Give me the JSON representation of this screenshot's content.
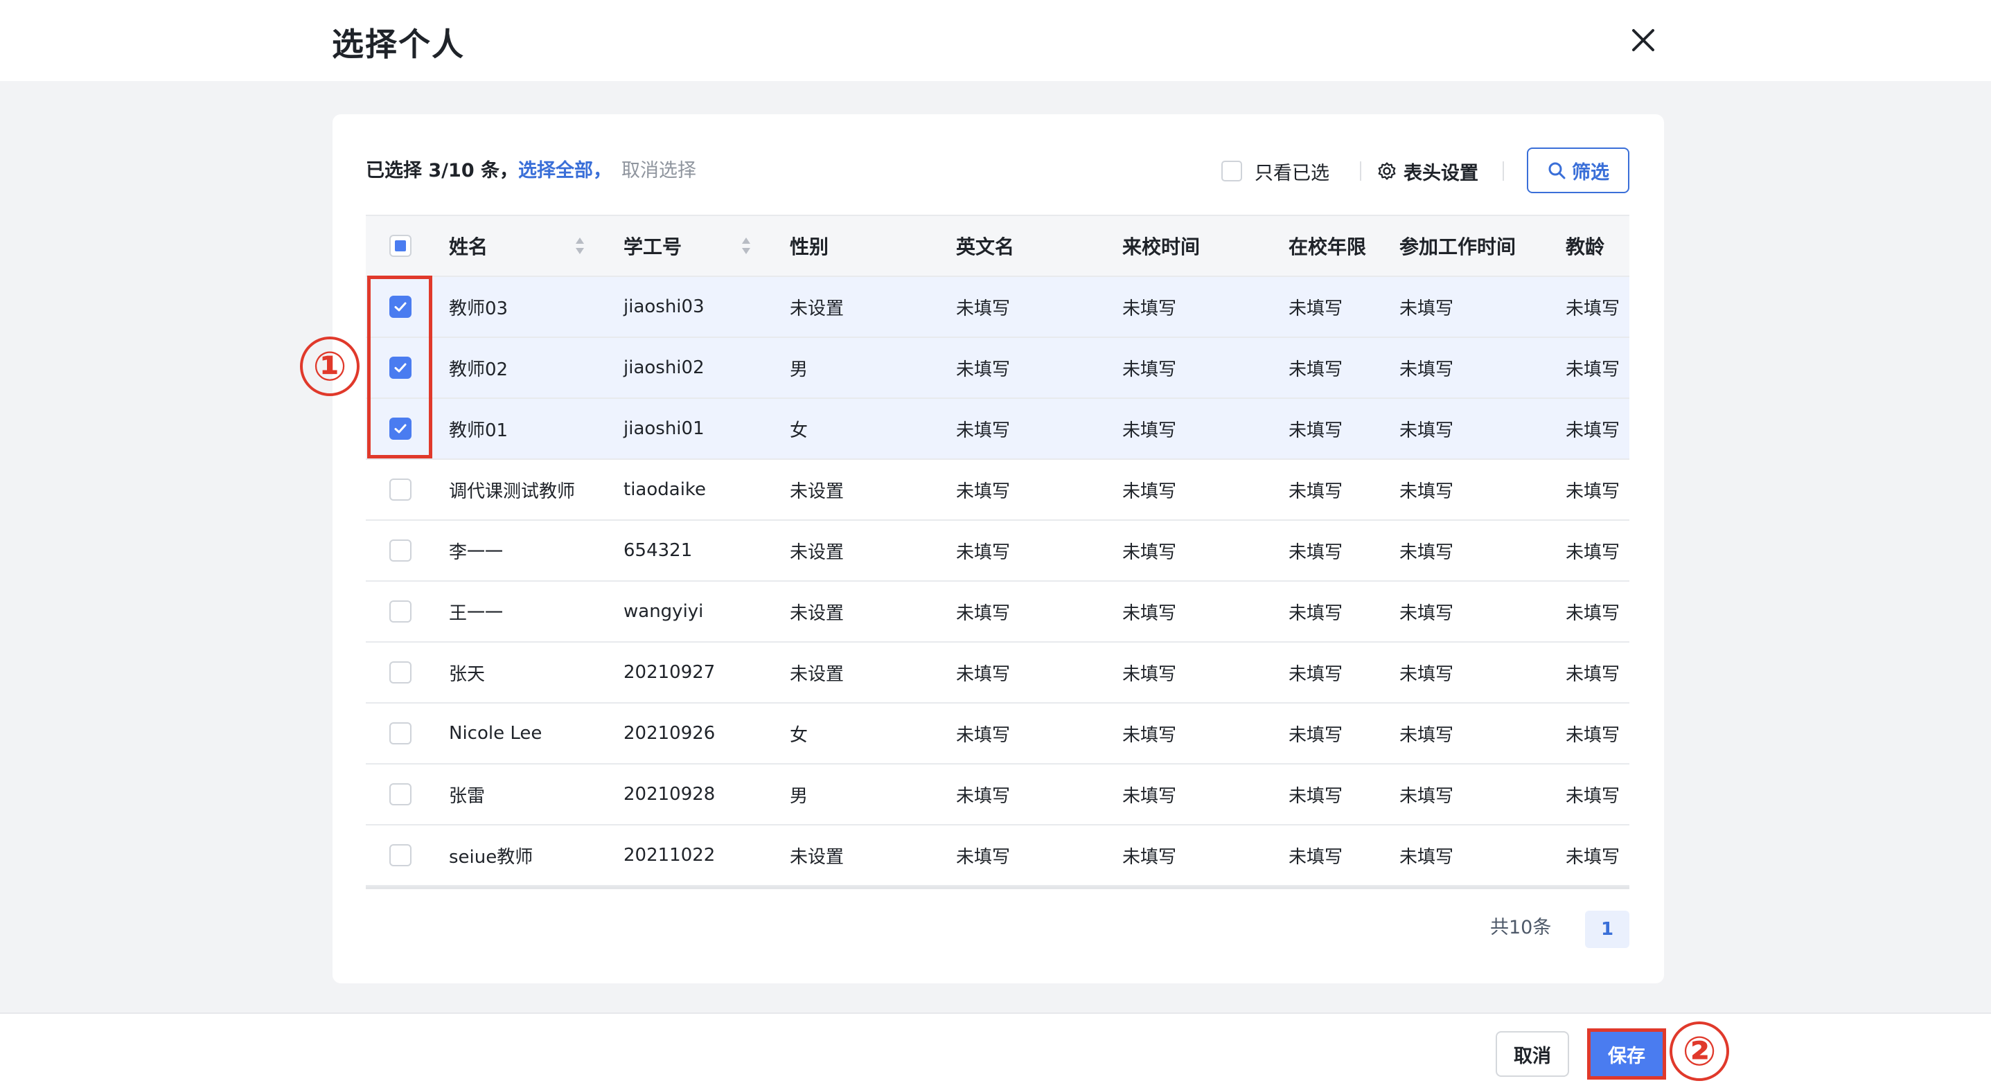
{
  "dialog": {
    "title": "选择个人"
  },
  "toolbar": {
    "selected_count": "已选择 3/10 条，",
    "select_all": "选择全部，",
    "cancel_selection": "取消选择",
    "only_selected": "只看已选",
    "header_settings": "表头设置",
    "filter": "筛选"
  },
  "table": {
    "columns": [
      "姓名",
      "学工号",
      "性别",
      "英文名",
      "来校时间",
      "在校年限",
      "参加工作时间",
      "教龄"
    ],
    "rows": [
      {
        "checked": true,
        "cells": [
          "教师03",
          "jiaoshi03",
          "未设置",
          "未填写",
          "未填写",
          "未填写",
          "未填写",
          "未填写"
        ]
      },
      {
        "checked": true,
        "cells": [
          "教师02",
          "jiaoshi02",
          "男",
          "未填写",
          "未填写",
          "未填写",
          "未填写",
          "未填写"
        ]
      },
      {
        "checked": true,
        "cells": [
          "教师01",
          "jiaoshi01",
          "女",
          "未填写",
          "未填写",
          "未填写",
          "未填写",
          "未填写"
        ]
      },
      {
        "checked": false,
        "cells": [
          "调代课测试教师",
          "tiaodaike",
          "未设置",
          "未填写",
          "未填写",
          "未填写",
          "未填写",
          "未填写"
        ]
      },
      {
        "checked": false,
        "cells": [
          "李一一",
          "654321",
          "未设置",
          "未填写",
          "未填写",
          "未填写",
          "未填写",
          "未填写"
        ]
      },
      {
        "checked": false,
        "cells": [
          "王一一",
          "wangyiyi",
          "未设置",
          "未填写",
          "未填写",
          "未填写",
          "未填写",
          "未填写"
        ]
      },
      {
        "checked": false,
        "cells": [
          "张天",
          "20210927",
          "未设置",
          "未填写",
          "未填写",
          "未填写",
          "未填写",
          "未填写"
        ]
      },
      {
        "checked": false,
        "cells": [
          "Nicole Lee",
          "20210926",
          "女",
          "未填写",
          "未填写",
          "未填写",
          "未填写",
          "未填写"
        ]
      },
      {
        "checked": false,
        "cells": [
          "张雷",
          "20210928",
          "男",
          "未填写",
          "未填写",
          "未填写",
          "未填写",
          "未填写"
        ]
      },
      {
        "checked": false,
        "cells": [
          "seiue教师",
          "20211022",
          "未设置",
          "未填写",
          "未填写",
          "未填写",
          "未填写",
          "未填写"
        ]
      }
    ]
  },
  "pagination": {
    "total": "共10条",
    "current_page": "1"
  },
  "footer": {
    "cancel": "取消",
    "save": "保存"
  },
  "annotations": {
    "step1": "①",
    "step2": "②"
  },
  "colors": {
    "accent": "#4a7cf0",
    "link": "#3a6fd8",
    "annotation": "#e0392b",
    "selected_row": "#eef3fe"
  },
  "icons": [
    "close-icon",
    "gear-icon",
    "search-icon",
    "sort-icon",
    "checkmark-icon"
  ]
}
